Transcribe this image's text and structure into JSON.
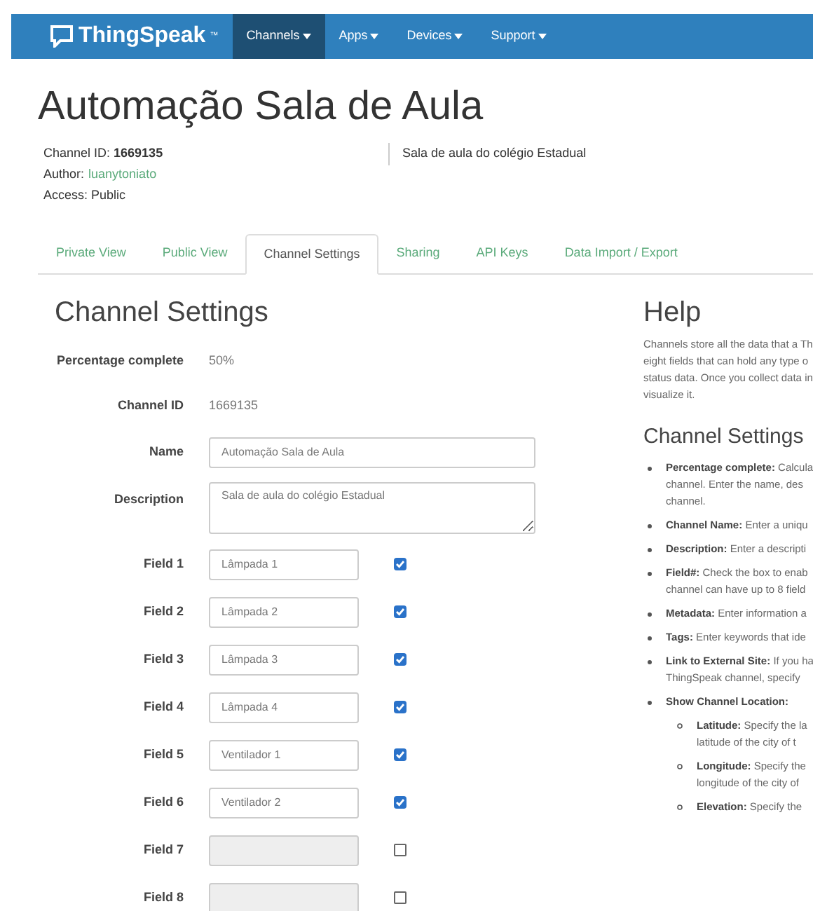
{
  "navbar": {
    "brand": "ThingSpeak",
    "trademark": "™",
    "items": [
      {
        "label": "Channels",
        "selected": true
      },
      {
        "label": "Apps",
        "selected": false
      },
      {
        "label": "Devices",
        "selected": false
      },
      {
        "label": "Support",
        "selected": false
      }
    ]
  },
  "title": "Automação Sala de Aula",
  "meta": {
    "channel_id_label": "Channel ID:",
    "channel_id": "1669135",
    "author_label": "Author:",
    "author": "luanytoniato",
    "access": "Access: Public",
    "description": "Sala de aula do colégio Estadual"
  },
  "tabs": [
    {
      "label": "Private View",
      "selected": false
    },
    {
      "label": "Public View",
      "selected": false
    },
    {
      "label": "Channel Settings",
      "selected": true
    },
    {
      "label": "Sharing",
      "selected": false
    },
    {
      "label": "API Keys",
      "selected": false
    },
    {
      "label": "Data Import / Export",
      "selected": false
    }
  ],
  "settings": {
    "heading": "Channel Settings",
    "percentage_label": "Percentage complete",
    "percentage": "50%",
    "channel_id_label": "Channel ID",
    "channel_id": "1669135",
    "name_label": "Name",
    "name": "Automação Sala de Aula",
    "description_label": "Description",
    "description": "Sala de aula do colégio Estadual",
    "fields": [
      {
        "label": "Field 1",
        "value": "Lâmpada 1",
        "checked": true,
        "disabled": false
      },
      {
        "label": "Field 2",
        "value": "Lâmpada 2",
        "checked": true,
        "disabled": false
      },
      {
        "label": "Field 3",
        "value": "Lâmpada 3",
        "checked": true,
        "disabled": false
      },
      {
        "label": "Field 4",
        "value": "Lâmpada 4",
        "checked": true,
        "disabled": false
      },
      {
        "label": "Field 5",
        "value": "Ventilador 1",
        "checked": true,
        "disabled": false
      },
      {
        "label": "Field 6",
        "value": "Ventilador 2",
        "checked": true,
        "disabled": false
      },
      {
        "label": "Field 7",
        "checked": false,
        "disabled": true
      },
      {
        "label": "Field 8",
        "checked": false,
        "disabled": true
      }
    ]
  },
  "help": {
    "heading": "Help",
    "paragraph": [
      "Channels store all the data that a Th",
      "eight fields that can hold any type o",
      "status data. Once you collect data in",
      "visualize it."
    ],
    "subheading": "Channel Settings",
    "items": [
      {
        "term": "Percentage complete:",
        "lines": [
          "Calcula",
          "channel. Enter the name, des",
          "channel."
        ]
      },
      {
        "term": "Channel Name:",
        "lines": [
          "Enter a uniqu"
        ]
      },
      {
        "term": "Description:",
        "lines": [
          "Enter a descripti"
        ]
      },
      {
        "term": "Field#:",
        "lines": [
          "Check the box to enab",
          "channel can have up to 8 field"
        ]
      },
      {
        "term": "Metadata:",
        "lines": [
          "Enter information a"
        ]
      },
      {
        "term": "Tags:",
        "lines": [
          "Enter keywords that ide"
        ]
      },
      {
        "term": "Link to External Site:",
        "lines": [
          "If you ha",
          "ThingSpeak channel, specify"
        ]
      },
      {
        "term": "Show Channel Location:",
        "children": [
          {
            "term": "Latitude:",
            "lines": [
              "Specify the la",
              "latitude of the city of t"
            ]
          },
          {
            "term": "Longitude:",
            "lines": [
              "Specify the",
              "longitude of the city of"
            ]
          },
          {
            "term": "Elevation:",
            "lines": [
              "Specify the"
            ]
          }
        ]
      }
    ]
  }
}
